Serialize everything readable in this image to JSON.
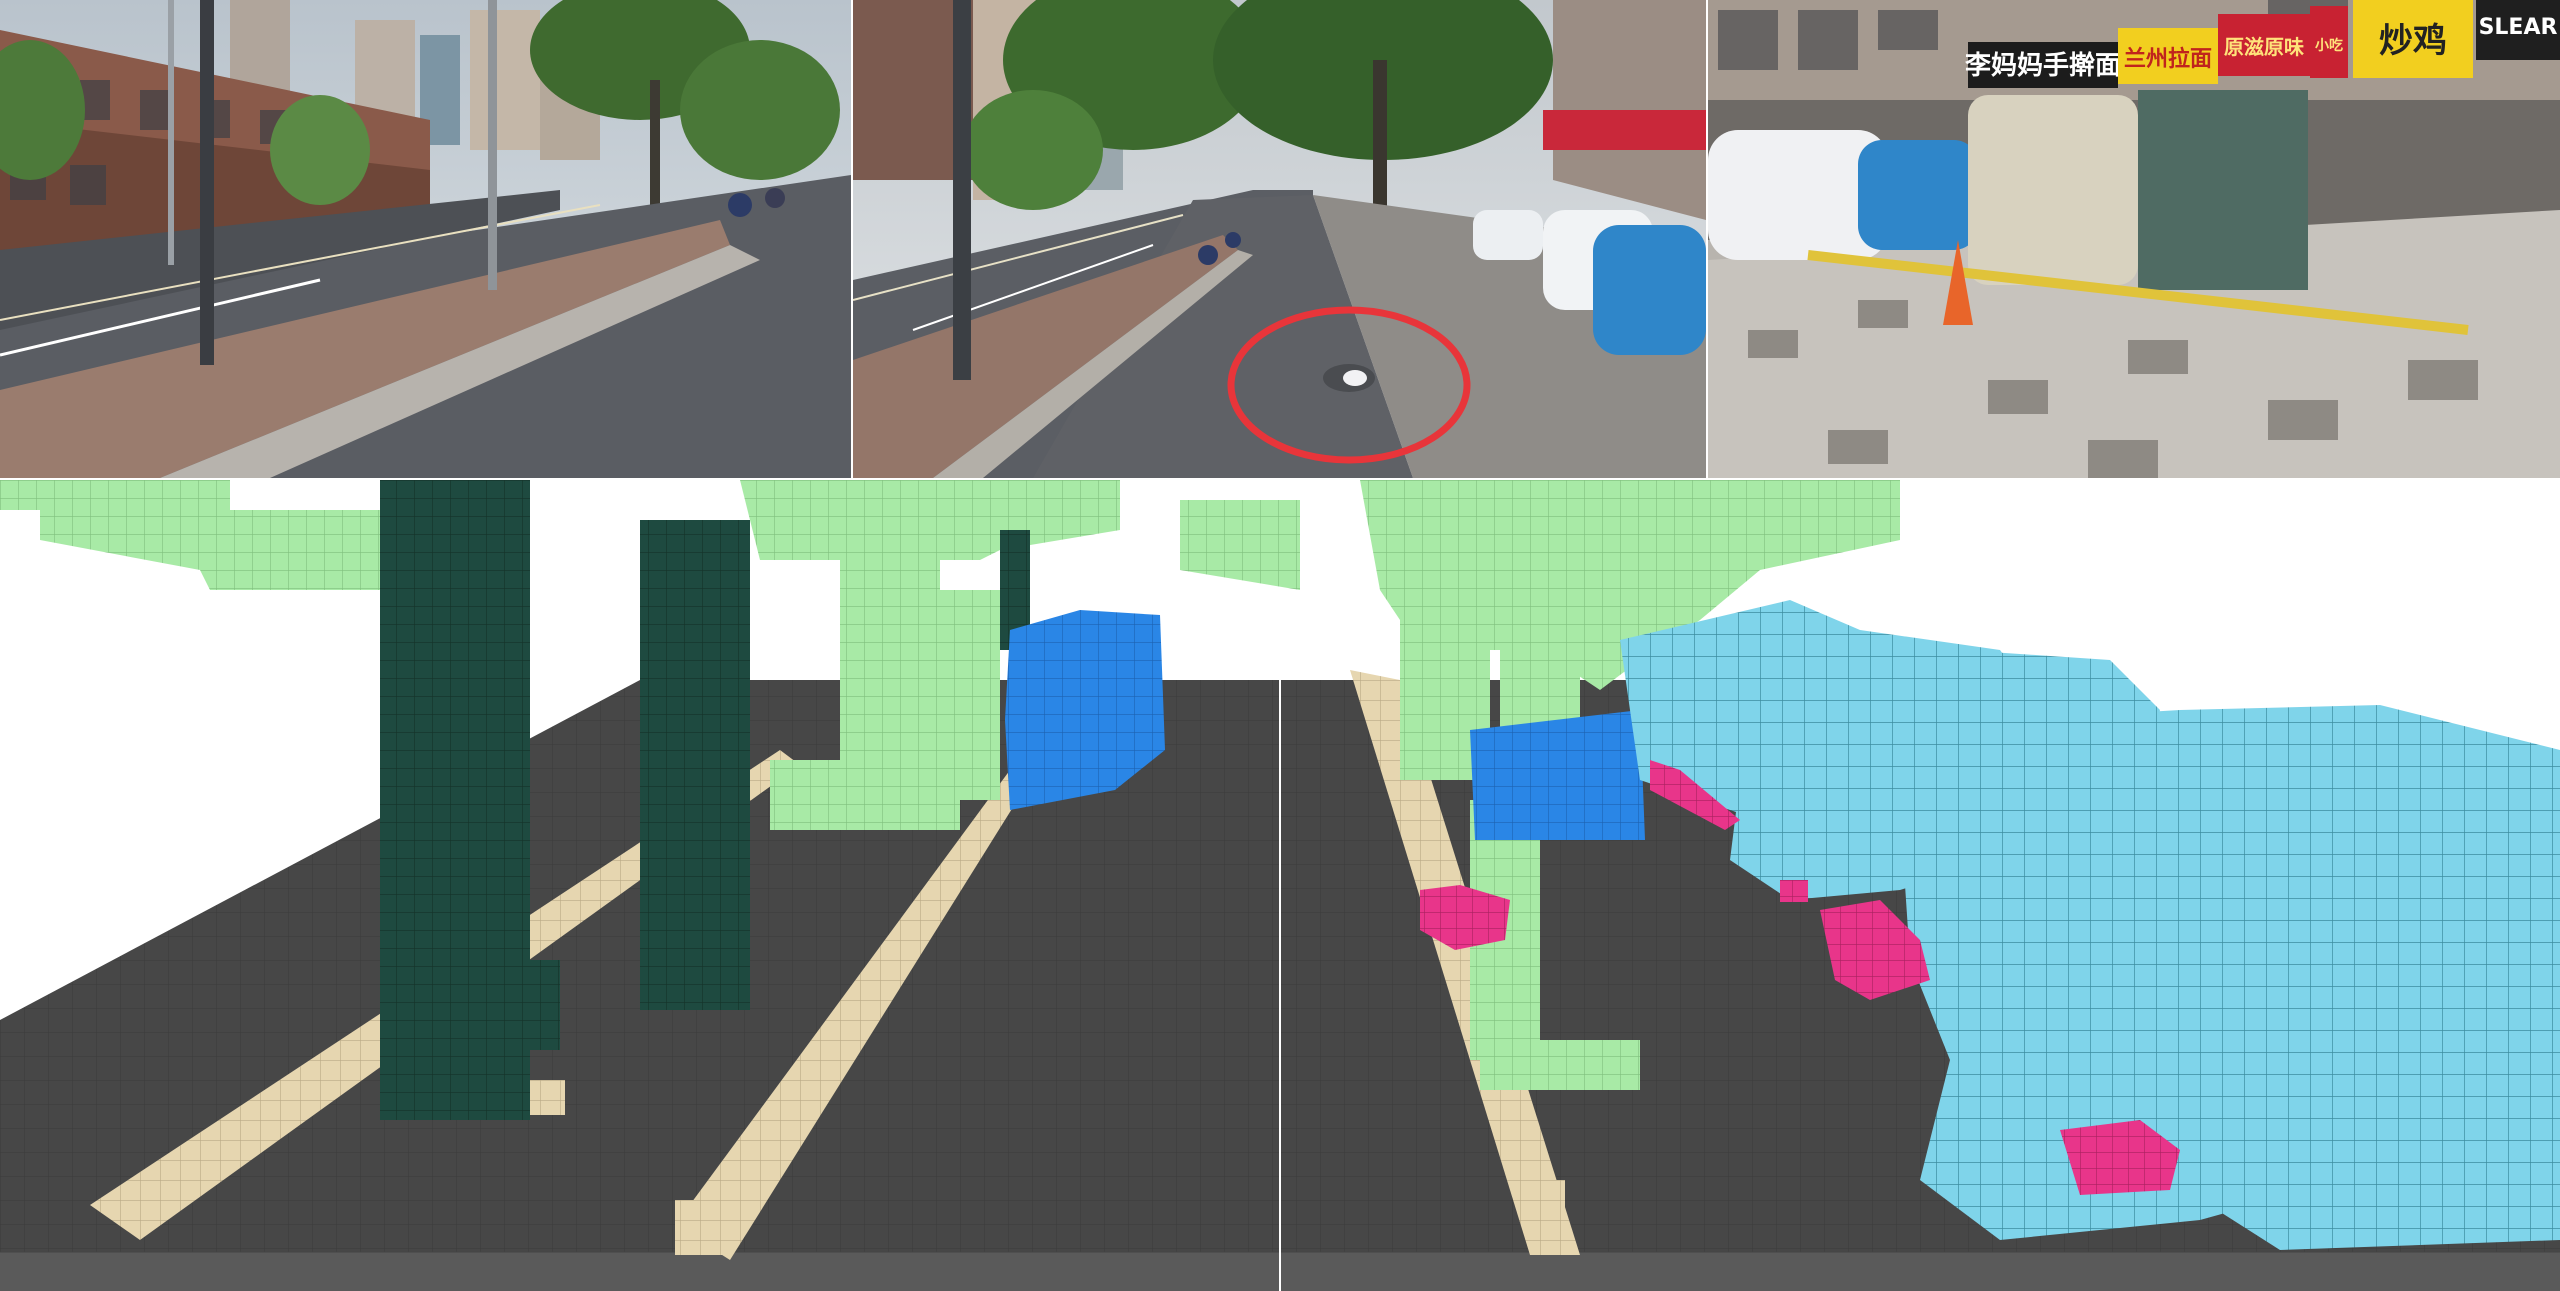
{
  "cameras": {
    "left": {
      "name": "camera-front-left"
    },
    "front": {
      "name": "camera-front",
      "highlight_color": "#e8353a"
    },
    "right": {
      "name": "camera-front-right"
    }
  },
  "storefront_signs": [
    {
      "text": "李妈妈手擀面",
      "bg": "#1c1c1c",
      "fg": "#ffffff"
    },
    {
      "text": "兰州拉面",
      "bg": "#f2cf1f",
      "fg": "#c0241d"
    },
    {
      "text": "原滋原味",
      "bg": "#c82232",
      "fg": "#ffe27a"
    },
    {
      "text": "小吃",
      "bg": "#c82232",
      "fg": "#ffe27a"
    },
    {
      "text": "炒鸡",
      "bg": "#f2cf1f",
      "fg": "#222222"
    },
    {
      "text": "SLEAR",
      "bg": "#1f1f1f",
      "fg": "#ffffff"
    }
  ],
  "occupancy_colors": {
    "vegetation": "#a8eaa6",
    "pole": "#1e4a40",
    "car": "#2a86e6",
    "parked_car": "#7fd4ea",
    "curb": "#e6d6b0",
    "pedestrian": "#e8358a",
    "ground": "#474747"
  }
}
